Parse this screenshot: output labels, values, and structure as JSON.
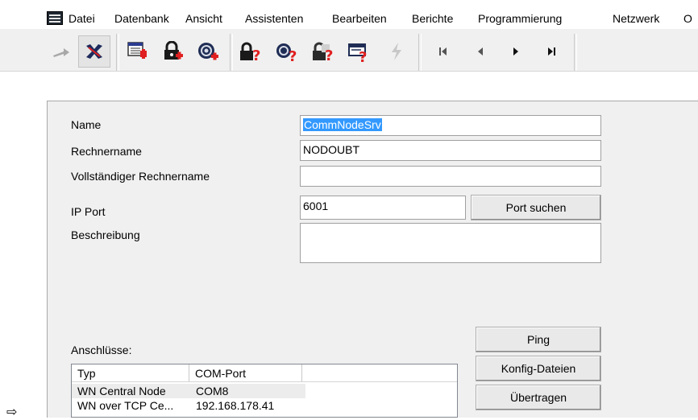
{
  "menu": {
    "items": [
      "Datei",
      "Datenbank",
      "Ansicht",
      "Assistenten",
      "Bearbeiten",
      "Berichte",
      "Programmierung",
      "Netzwerk",
      "O"
    ]
  },
  "toolbar": {
    "buttons": [
      {
        "icon": "back-arrow-icon"
      },
      {
        "icon": "delete-icon"
      },
      {
        "icon": "new-list-icon"
      },
      {
        "icon": "new-lock-icon"
      },
      {
        "icon": "new-transponder-icon"
      },
      {
        "icon": "lock-query-icon"
      },
      {
        "icon": "transponder-query-icon"
      },
      {
        "icon": "lock-query-grey-icon"
      },
      {
        "icon": "window-query-icon"
      },
      {
        "icon": "lightning-icon"
      },
      {
        "icon": "first-record-icon"
      },
      {
        "icon": "previous-record-icon"
      },
      {
        "icon": "next-record-icon"
      },
      {
        "icon": "last-record-icon"
      }
    ]
  },
  "form": {
    "name_label": "Name",
    "name_value": "CommNodeSrv",
    "computer_label": "Rechnername",
    "computer_value": "NODOUBT",
    "full_computer_label": "Vollständiger Rechnername",
    "full_computer_value": "",
    "port_label": "IP Port",
    "port_value": "6001",
    "port_search_label": "Port suchen",
    "description_label": "Beschreibung",
    "description_value": ""
  },
  "connections": {
    "label": "Anschlüsse:",
    "columns": [
      "Typ",
      "COM-Port",
      ""
    ],
    "rows": [
      {
        "typ": "WN Central Node",
        "port": "COM8"
      },
      {
        "typ": "WN over TCP Ce...",
        "port": "192.168.178.41"
      }
    ]
  },
  "actions": {
    "ping_label": "Ping",
    "config_label": "Konfig-Dateien",
    "transfer_label": "Übertragen"
  },
  "pointer": "⇨",
  "colors": {
    "selection": "#3399ff",
    "panel": "#f0f0f0",
    "toolbar": "#f0f0f0",
    "red_accent": "#e02020"
  }
}
